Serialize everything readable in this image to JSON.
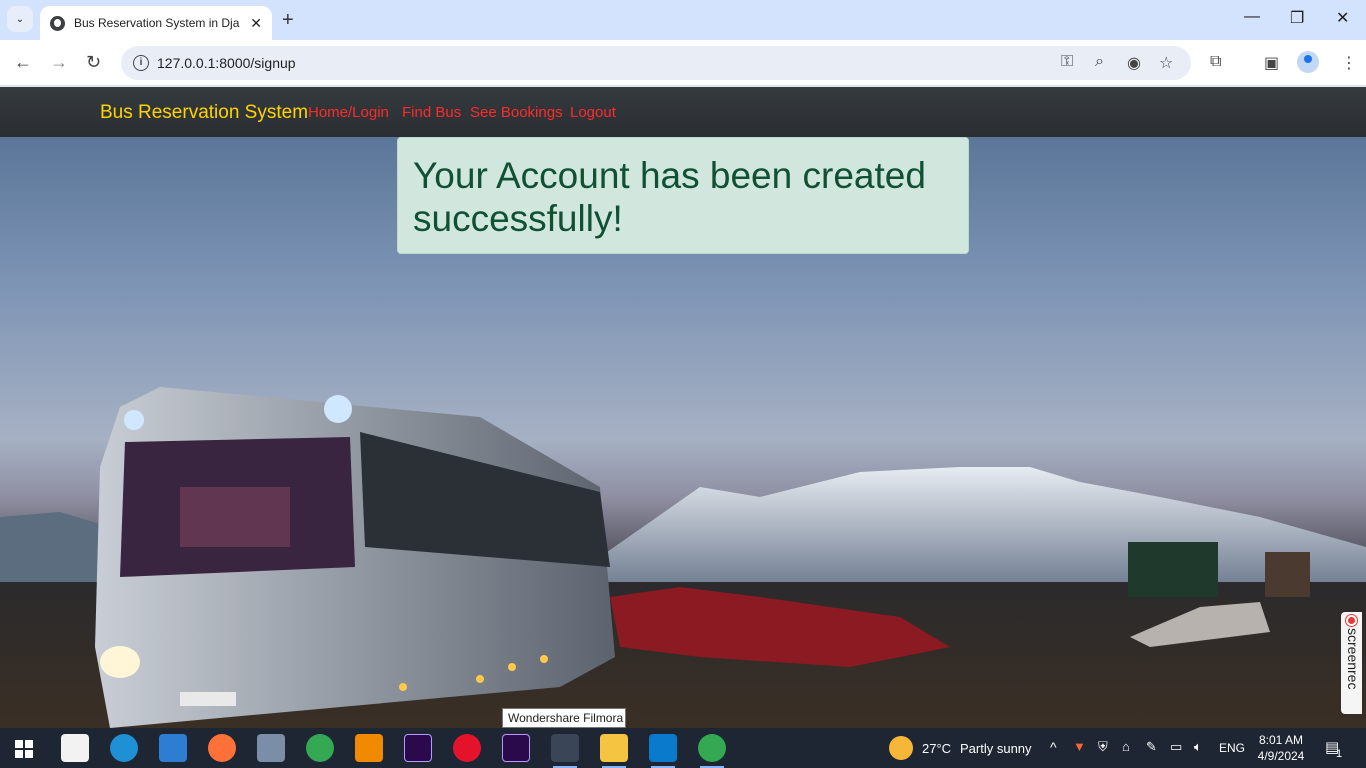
{
  "browser": {
    "tab_title": "Bus Reservation System in Djan",
    "url": "127.0.0.1:8000/signup",
    "icons": [
      "search-tabs-icon",
      "new-tab-icon",
      "minimize-icon",
      "maximize-icon",
      "close-window-icon",
      "back-icon",
      "forward-icon",
      "reload-icon",
      "site-info-icon",
      "password-key-icon",
      "zoom-icon",
      "eye-icon",
      "bookmark-star-icon",
      "extensions-icon",
      "side-panel-icon",
      "profile-icon",
      "menu-icon"
    ]
  },
  "site": {
    "brand": "Bus Reservation System",
    "nav": [
      {
        "label": "Home/Login"
      },
      {
        "label": "Find Bus"
      },
      {
        "label": "See Bookings"
      },
      {
        "label": "Logout"
      }
    ],
    "alert_message": "Your Account has been created successfully!",
    "colors": {
      "brand": "#ffd400",
      "nav_link": "#ff2a2a",
      "alert_bg": "#d1e7dd",
      "alert_text": "#0f5132"
    }
  },
  "overlay": {
    "screenrec_label": "screenrec",
    "tooltip": "Wondershare Filmora"
  },
  "taskbar": {
    "apps": [
      "windows-start-icon",
      "microsoft-store-icon",
      "edge-icon",
      "mail-icon",
      "firefox-icon",
      "photo-app-icon",
      "chrome-icon",
      "vlc-icon",
      "after-effects-icon",
      "opera-icon",
      "after-effects-icon-2",
      "filmora-icon",
      "file-explorer-icon",
      "vscode-icon",
      "chrome-active-icon"
    ],
    "weather_temp": "27°C",
    "weather_desc": "Partly sunny",
    "language": "ENG",
    "time": "8:01 AM",
    "date": "4/9/2024",
    "notification_count": "1"
  }
}
